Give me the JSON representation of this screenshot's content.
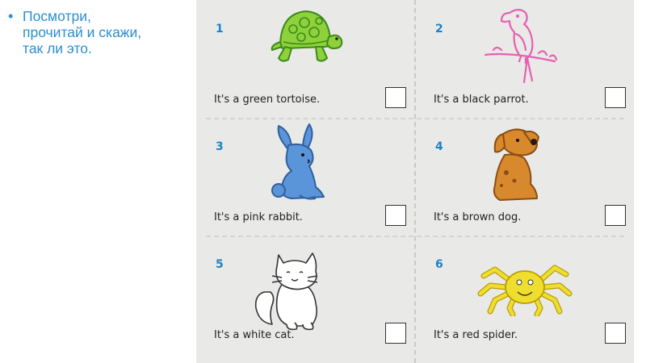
{
  "instruction": {
    "lines": [
      "Посмотри,",
      "прочитай и скажи,",
      "так ли это."
    ]
  },
  "worksheet": {
    "items": [
      {
        "number": "1",
        "sentence": "It's a green tortoise.",
        "animal_icon": "tortoise-icon",
        "color": "#8ed13a"
      },
      {
        "number": "2",
        "sentence": "It's a black parrot.",
        "animal_icon": "parrot-icon",
        "color": "#e85fb1"
      },
      {
        "number": "3",
        "sentence": "It's a pink rabbit.",
        "animal_icon": "rabbit-icon",
        "color": "#5b95d9"
      },
      {
        "number": "4",
        "sentence": "It's a brown dog.",
        "animal_icon": "dog-icon",
        "color": "#d9892d"
      },
      {
        "number": "5",
        "sentence": "It's a white cat.",
        "animal_icon": "cat-icon",
        "color": "#ffffff"
      },
      {
        "number": "6",
        "sentence": "It's a red spider.",
        "animal_icon": "spider-icon",
        "color": "#f0de2e"
      }
    ]
  }
}
